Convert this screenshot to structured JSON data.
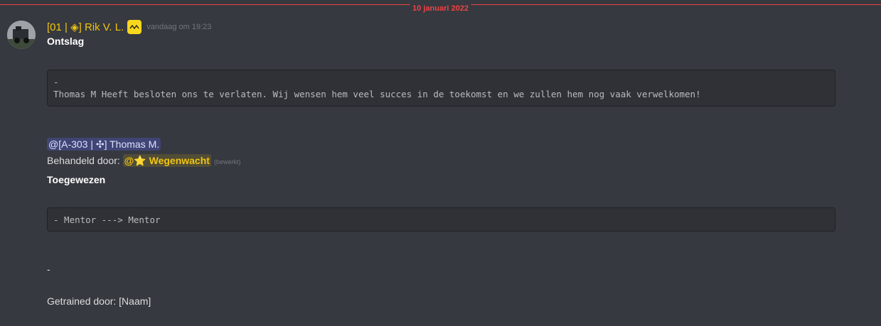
{
  "divider": {
    "date": "10 januari 2022"
  },
  "message": {
    "author": "[01 | ◈] Rik V. L.",
    "timestamp": "vandaag om 19:23",
    "title": "Ontslag",
    "code1_line1": "-",
    "code1_line2": "Thomas M Heeft besloten ons te verlaten. Wij wensen hem veel succes in de toekomst en we zullen hem nog vaak verwelkomen!",
    "mention_user": "@[A-303 | ✣] Thomas M.",
    "handled_by_label": "Behandeld door: ",
    "role_mention": "@⭐ Wegenwacht",
    "edited_label": "(bewerkt)",
    "assigned_title": "Toegewezen",
    "code2_line1": "- Mentor ---> Mentor",
    "dash_line": "-",
    "trained_by": "Getrained door: [Naam]"
  }
}
